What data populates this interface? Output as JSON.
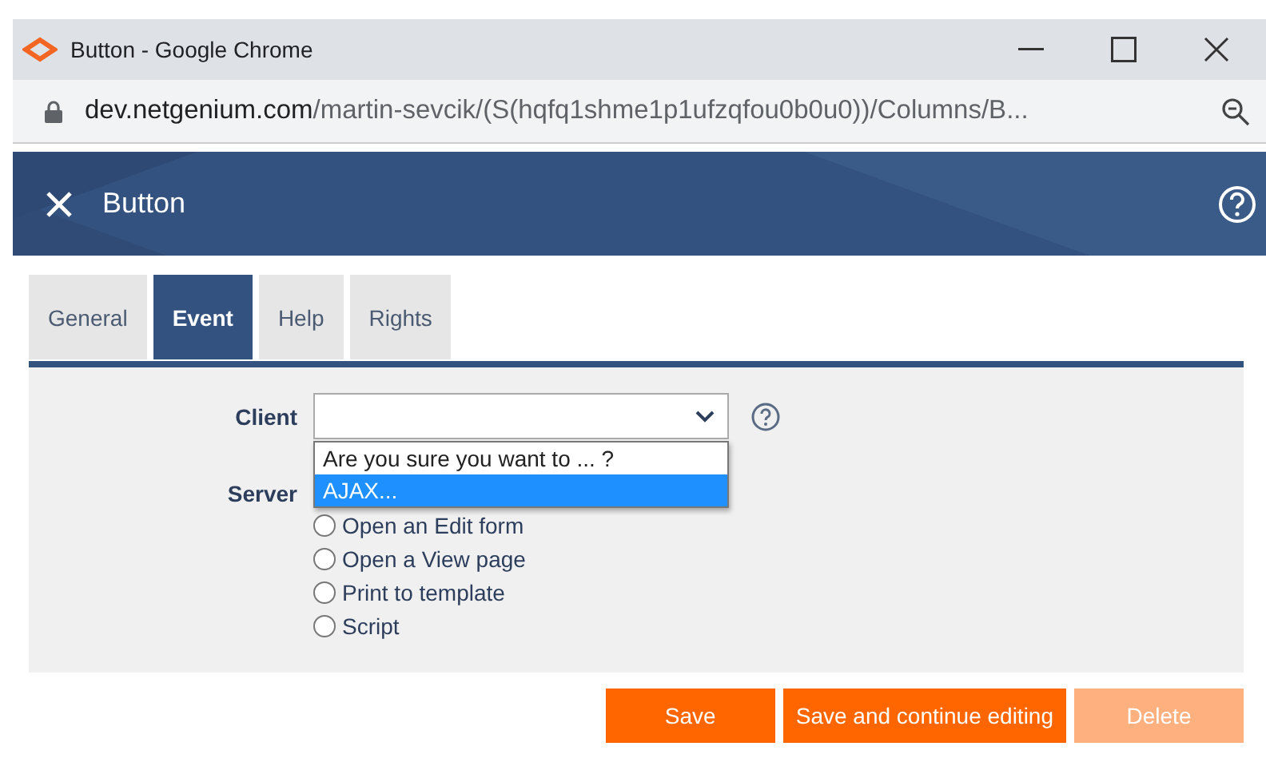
{
  "window": {
    "title": "Button - Google Chrome"
  },
  "address": {
    "domain": "dev.netgenium.com",
    "path": "/martin-sevcik/(S(hqfq1shme1p1ufzqfou0b0u0))/Columns/B..."
  },
  "header": {
    "title": "Button"
  },
  "tabs": [
    {
      "label": "General",
      "selected": false
    },
    {
      "label": "Event",
      "selected": true
    },
    {
      "label": "Help",
      "selected": false
    },
    {
      "label": "Rights",
      "selected": false
    }
  ],
  "client": {
    "label": "Client",
    "options": [
      {
        "label": "Are you sure you want to ... ?",
        "selected": false
      },
      {
        "label": "AJAX...",
        "selected": true
      }
    ]
  },
  "server": {
    "label": "Server",
    "options": [
      {
        "label": "Open an Edit form",
        "checked": false
      },
      {
        "label": "Open a View page",
        "checked": false
      },
      {
        "label": "Print to template",
        "checked": false
      },
      {
        "label": "Script",
        "checked": false
      }
    ]
  },
  "buttons": [
    {
      "label": "Save",
      "disabled": false
    },
    {
      "label": "Save and continue editing",
      "disabled": false
    },
    {
      "label": "Delete",
      "disabled": true
    }
  ]
}
